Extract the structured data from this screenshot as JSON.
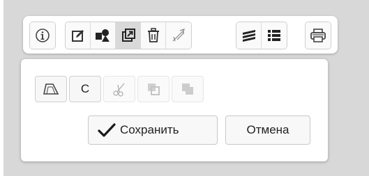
{
  "toolbar": {
    "groups": [
      [
        "info-icon"
      ],
      [
        "edit-icon",
        "shapes-icon",
        "external-link-icon",
        "trash-icon",
        "measure-icon"
      ],
      [
        "layers-icon",
        "list-icon"
      ],
      [
        "print-icon"
      ]
    ],
    "active": "external-link-icon"
  },
  "panel": {
    "tools": [
      {
        "icon": "polygon-icon",
        "enabled": true
      },
      {
        "label": "C",
        "enabled": true
      },
      {
        "icon": "scissors-icon",
        "enabled": false
      },
      {
        "icon": "copy-icon",
        "enabled": false
      },
      {
        "icon": "union-icon",
        "enabled": false
      }
    ],
    "save_label": "Сохранить",
    "cancel_label": "Отмена"
  },
  "colors": {
    "background": "#d8d8d8",
    "icon": "#333333",
    "disabled_icon": "#bbbbbb"
  }
}
